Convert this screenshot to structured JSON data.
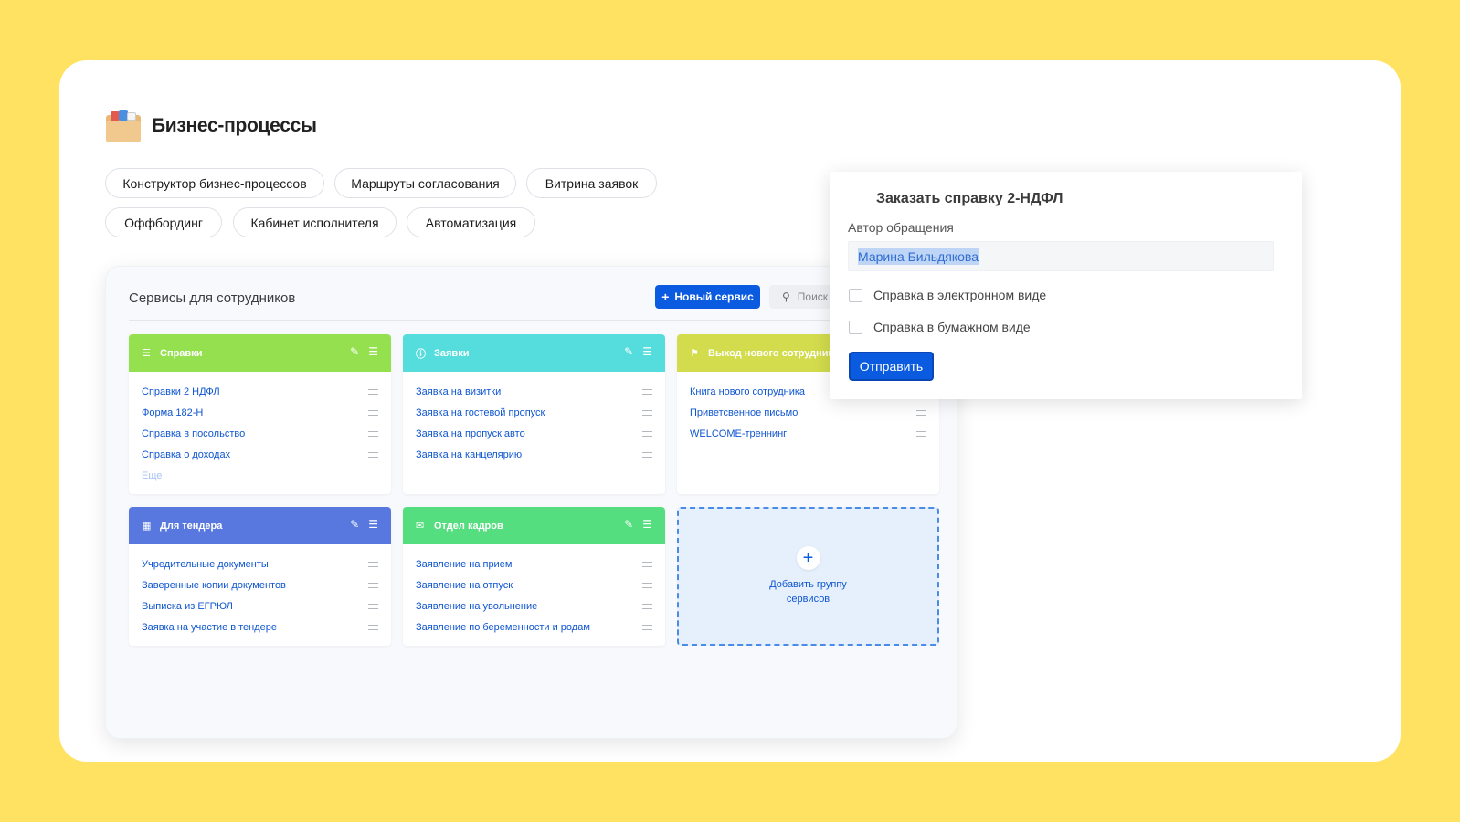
{
  "page_title": "Бизнес-процессы",
  "tabs": [
    {
      "label": "Конструктор бизнес-процессов"
    },
    {
      "label": "Маршруты согласования"
    },
    {
      "label": "Витрина заявок"
    },
    {
      "label": "Оффбординг"
    },
    {
      "label": "Кабинет исполнителя"
    },
    {
      "label": "Автоматизация"
    }
  ],
  "panel": {
    "title": "Сервисы для сотрудников",
    "new_service_label": "Новый сервис",
    "search_placeholder": "Поиск"
  },
  "groups": [
    {
      "title": "Справки",
      "color": "#95E04F",
      "icon": "list-icon",
      "items": [
        "Справки 2 НДФЛ",
        "Форма 182-Н",
        "Справка в посольство",
        "Справка о доходах"
      ],
      "more": "Еще"
    },
    {
      "title": "Заявки",
      "color": "#55DDDD",
      "icon": "question-circle-icon",
      "items": [
        "Заявка на визитки",
        "Заявка на гостевой пропуск",
        "Заявка на пропуск авто",
        "Заявка на канцелярию"
      ]
    },
    {
      "title": "Выход нового сотрудника",
      "color": "#D2DC4C",
      "icon": "flag-icon",
      "items": [
        "Книга нового сотрудника",
        "Приветсвенное письмо",
        "WELCOME-треннинг"
      ]
    },
    {
      "title": "Для тендера",
      "color": "#5878DF",
      "icon": "map-icon",
      "items": [
        "Учредительные документы",
        "Заверенные копии документов",
        "Выписка из ЕГРЮЛ",
        "Заявка на участие в тендере"
      ]
    },
    {
      "title": "Отдел кадров",
      "color": "#55DE7F",
      "icon": "mail-icon",
      "items": [
        "Заявление на прием",
        "Заявление на отпуск",
        "Заявление  на увольнение",
        "Заявление  по беременности и родам"
      ]
    }
  ],
  "add_group": {
    "label": "Добавить группу сервисов"
  },
  "modal": {
    "title": "Заказать справку 2-НДФЛ",
    "author_label": "Автор обращения",
    "author_value": "Марина Бильдякова",
    "option_electronic": "Справка в электронном виде",
    "option_paper": "Справка в бумажном виде",
    "submit_label": "Отправить"
  }
}
